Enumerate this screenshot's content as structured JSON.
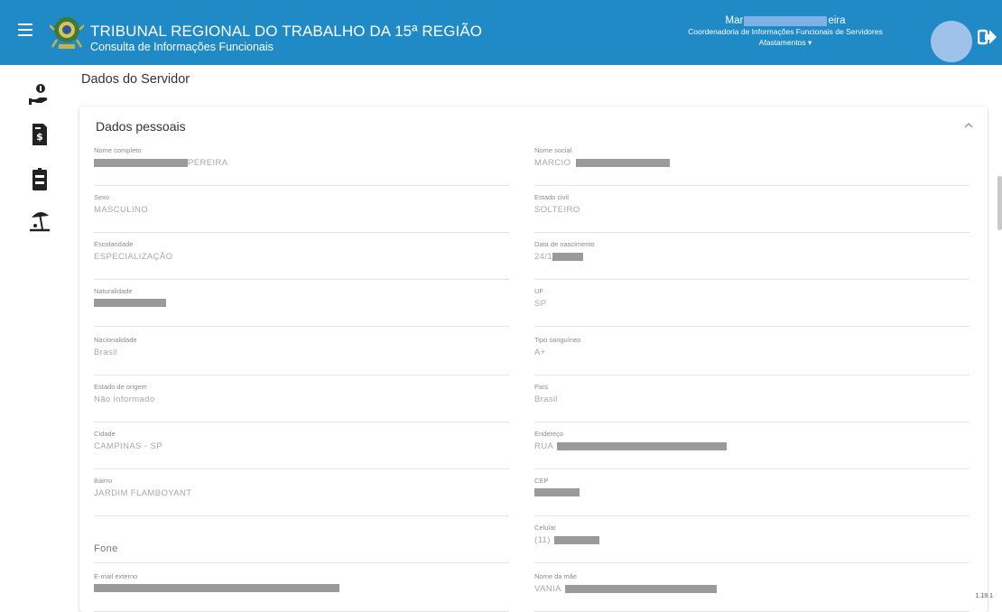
{
  "header": {
    "org_title": "TRIBUNAL REGIONAL DO TRABALHO DA 15ª REGIÃO",
    "app_subtitle": "Consulta de Informações Funcionais",
    "user_name_prefix": "Mar",
    "user_name_suffix": "eira",
    "user_department": "Coordenadoria de Informações Funcionais de Servidores",
    "user_menu": "Afastamentos ▾"
  },
  "rail": {
    "items": [
      "salary-icon",
      "payslip-icon",
      "badge-icon",
      "vacation-icon"
    ]
  },
  "page": {
    "title": "Dados do Servidor"
  },
  "card": {
    "title": "Dados pessoais",
    "fields_left": [
      {
        "label": "Nome completo",
        "value": "PEREIRA",
        "redacted_prefix": true
      },
      {
        "label": "Sexo",
        "value": "MASCULINO"
      },
      {
        "label": "Escolaridade",
        "value": "ESPECIALIZAÇÃO"
      },
      {
        "label": "Naturalidade",
        "value": "",
        "redacted": true
      },
      {
        "label": "Nacionalidade",
        "value": "Brasil"
      },
      {
        "label": "Estado de origem",
        "value": "Não informado"
      },
      {
        "label": "Cidade",
        "value": "CAMPINAS - SP"
      },
      {
        "label": "Bairro",
        "value": "JARDIM FLAMBOYANT"
      },
      {
        "label": "",
        "value": "Fone"
      },
      {
        "label": "E-mail externo",
        "value": "",
        "redacted": true
      }
    ],
    "fields_right": [
      {
        "label": "Nome social",
        "value": "MARCIO",
        "redacted_suffix": true
      },
      {
        "label": "Estado civil",
        "value": "SOLTEIRO"
      },
      {
        "label": "Data de nascimento",
        "value": "24/1",
        "redacted_suffix": true
      },
      {
        "label": "UF",
        "value": "SP"
      },
      {
        "label": "Tipo sanguíneo",
        "value": "A+"
      },
      {
        "label": "País",
        "value": "Brasil"
      },
      {
        "label": "Endereço",
        "value": "RUA",
        "redacted_suffix": true
      },
      {
        "label": "CEP",
        "value": "",
        "redacted": true
      },
      {
        "label": "Celular",
        "value": "(11)",
        "redacted_suffix": true
      },
      {
        "label": "Nome da mãe",
        "value": "VANIA",
        "redacted_suffix": true
      }
    ]
  },
  "footer": {
    "version": "1.19.1"
  },
  "colors": {
    "header_bg": "#1f8ac6",
    "avatar": "#9fc2ea"
  }
}
